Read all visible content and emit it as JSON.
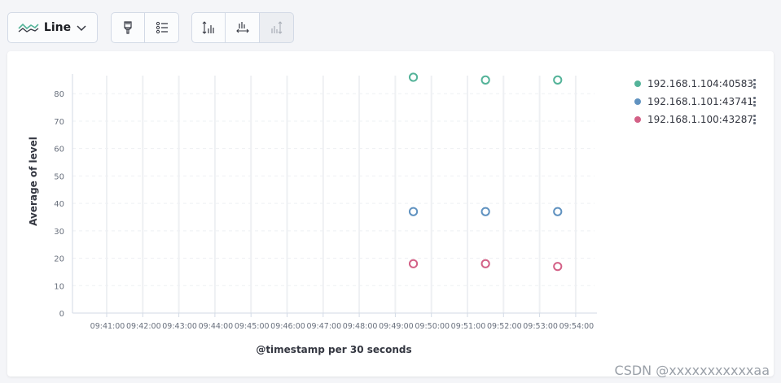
{
  "toolbar": {
    "chart_type_label": "Line",
    "icons": [
      "line-chart-icon",
      "chevron-down-icon",
      "brush-icon",
      "list-settings-icon",
      "y-axis-icon",
      "x-axis-icon",
      "split-axis-icon"
    ]
  },
  "watermark": "CSDN @xxxxxxxxxxxaa",
  "colors": {
    "series": [
      "#54b399",
      "#6092c0",
      "#d36086"
    ],
    "grid": "#eef0f3",
    "axis": "#d3dae6",
    "tick_text": "#69707d"
  },
  "chart_data": {
    "type": "scatter",
    "ylabel": "Average of level",
    "xlabel": "@timestamp per 30 seconds",
    "x_ticks": [
      "09:41:00",
      "09:42:00",
      "09:43:00",
      "09:44:00",
      "09:45:00",
      "09:46:00",
      "09:47:00",
      "09:48:00",
      "09:49:00",
      "09:50:00",
      "09:51:00",
      "09:52:00",
      "09:53:00",
      "09:54:00"
    ],
    "y_ticks": [
      0,
      10,
      20,
      30,
      40,
      50,
      60,
      70,
      80
    ],
    "ylim": [
      0,
      86
    ],
    "grid": true,
    "legend_position": "right",
    "x": [
      "09:49:30",
      "09:51:30",
      "09:53:30"
    ],
    "series": [
      {
        "name": "192.168.1.104:40583",
        "values": [
          86,
          85,
          85
        ]
      },
      {
        "name": "192.168.1.101:43741",
        "values": [
          37,
          37,
          37
        ]
      },
      {
        "name": "192.168.1.100:43287",
        "values": [
          18,
          18,
          17
        ]
      }
    ]
  }
}
